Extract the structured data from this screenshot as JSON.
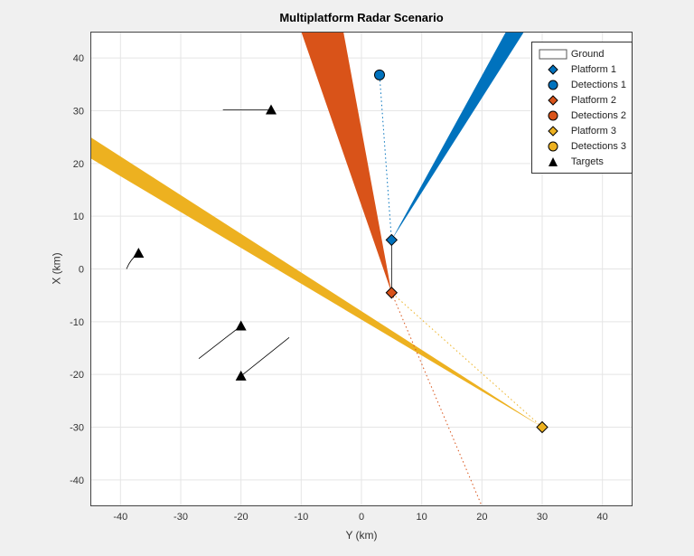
{
  "chart_data": {
    "type": "scatter",
    "title": "Multiplatform Radar Scenario",
    "xlabel": "Y (km)",
    "ylabel": "X (km)",
    "xlim": [
      -45,
      45
    ],
    "ylim": [
      -45,
      45
    ],
    "x_ticks": [
      -40,
      -30,
      -20,
      -10,
      0,
      10,
      20,
      30,
      40
    ],
    "y_ticks": [
      -40,
      -30,
      -20,
      -10,
      0,
      10,
      20,
      30,
      40
    ],
    "grid": true,
    "series": [
      {
        "name": "Ground",
        "type": "patch"
      },
      {
        "name": "Platform 1",
        "marker": "diamond",
        "color": "#0072BD",
        "points": [
          {
            "y": 5,
            "x": 5.5
          }
        ]
      },
      {
        "name": "Detections 1",
        "marker": "circle",
        "color": "#0072BD",
        "points": [
          {
            "y": 3,
            "x": 36.8
          }
        ]
      },
      {
        "name": "Platform 2",
        "marker": "diamond",
        "color": "#D95319",
        "points": [
          {
            "y": 5,
            "x": -4.5
          }
        ]
      },
      {
        "name": "Detections 2",
        "marker": "circle",
        "color": "#D95319",
        "points": []
      },
      {
        "name": "Platform 3",
        "marker": "diamond",
        "color": "#EDB120",
        "points": [
          {
            "y": 30,
            "x": -30
          }
        ]
      },
      {
        "name": "Detections 3",
        "marker": "circle",
        "color": "#EDB120",
        "points": []
      },
      {
        "name": "Targets",
        "marker": "triangle",
        "color": "#000000",
        "points": [
          {
            "y": -37,
            "x": 3
          },
          {
            "y": -15,
            "x": 30.2
          },
          {
            "y": -20,
            "x": -10.8
          },
          {
            "y": -20,
            "x": -20.3
          }
        ]
      }
    ],
    "beams": [
      {
        "color": "#EDB120",
        "vertices": [
          [
            30,
            -30
          ],
          [
            -45,
            21
          ],
          [
            -45,
            25
          ]
        ]
      },
      {
        "color": "#D95319",
        "vertices": [
          [
            5,
            -4.5
          ],
          [
            -5,
            45
          ],
          [
            -3,
            45
          ]
        ]
      },
      {
        "color": "#0072BD",
        "vertices": [
          [
            5,
            5.5
          ],
          [
            24,
            45
          ],
          [
            27,
            45
          ]
        ]
      }
    ],
    "dashed_lines": [
      {
        "color": "#D95319",
        "from": [
          5,
          -4.5
        ],
        "to": [
          20,
          -45
        ]
      },
      {
        "color": "#EDB120",
        "from": [
          30,
          -30
        ],
        "to": [
          5,
          -4.5
        ]
      },
      {
        "color": "#0072BD",
        "from": [
          5,
          5.5
        ],
        "to": [
          3,
          36.8
        ]
      }
    ],
    "trails": [
      {
        "from": [
          -37,
          3
        ],
        "to": [
          -39,
          0
        ],
        "curve": true
      },
      {
        "from": [
          -15,
          30.2
        ],
        "to": [
          -23,
          30.2
        ]
      },
      {
        "from": [
          5,
          5.5
        ],
        "to": [
          5,
          -4.5
        ]
      },
      {
        "from": [
          -20,
          -10.8
        ],
        "to": [
          -27,
          -17
        ]
      },
      {
        "from": [
          -20,
          -20.3
        ],
        "to": [
          -12,
          -13
        ]
      }
    ],
    "legend_entries": [
      "Ground",
      "Platform 1",
      "Detections 1",
      "Platform 2",
      "Detections 2",
      "Platform 3",
      "Detections 3",
      "Targets"
    ]
  }
}
